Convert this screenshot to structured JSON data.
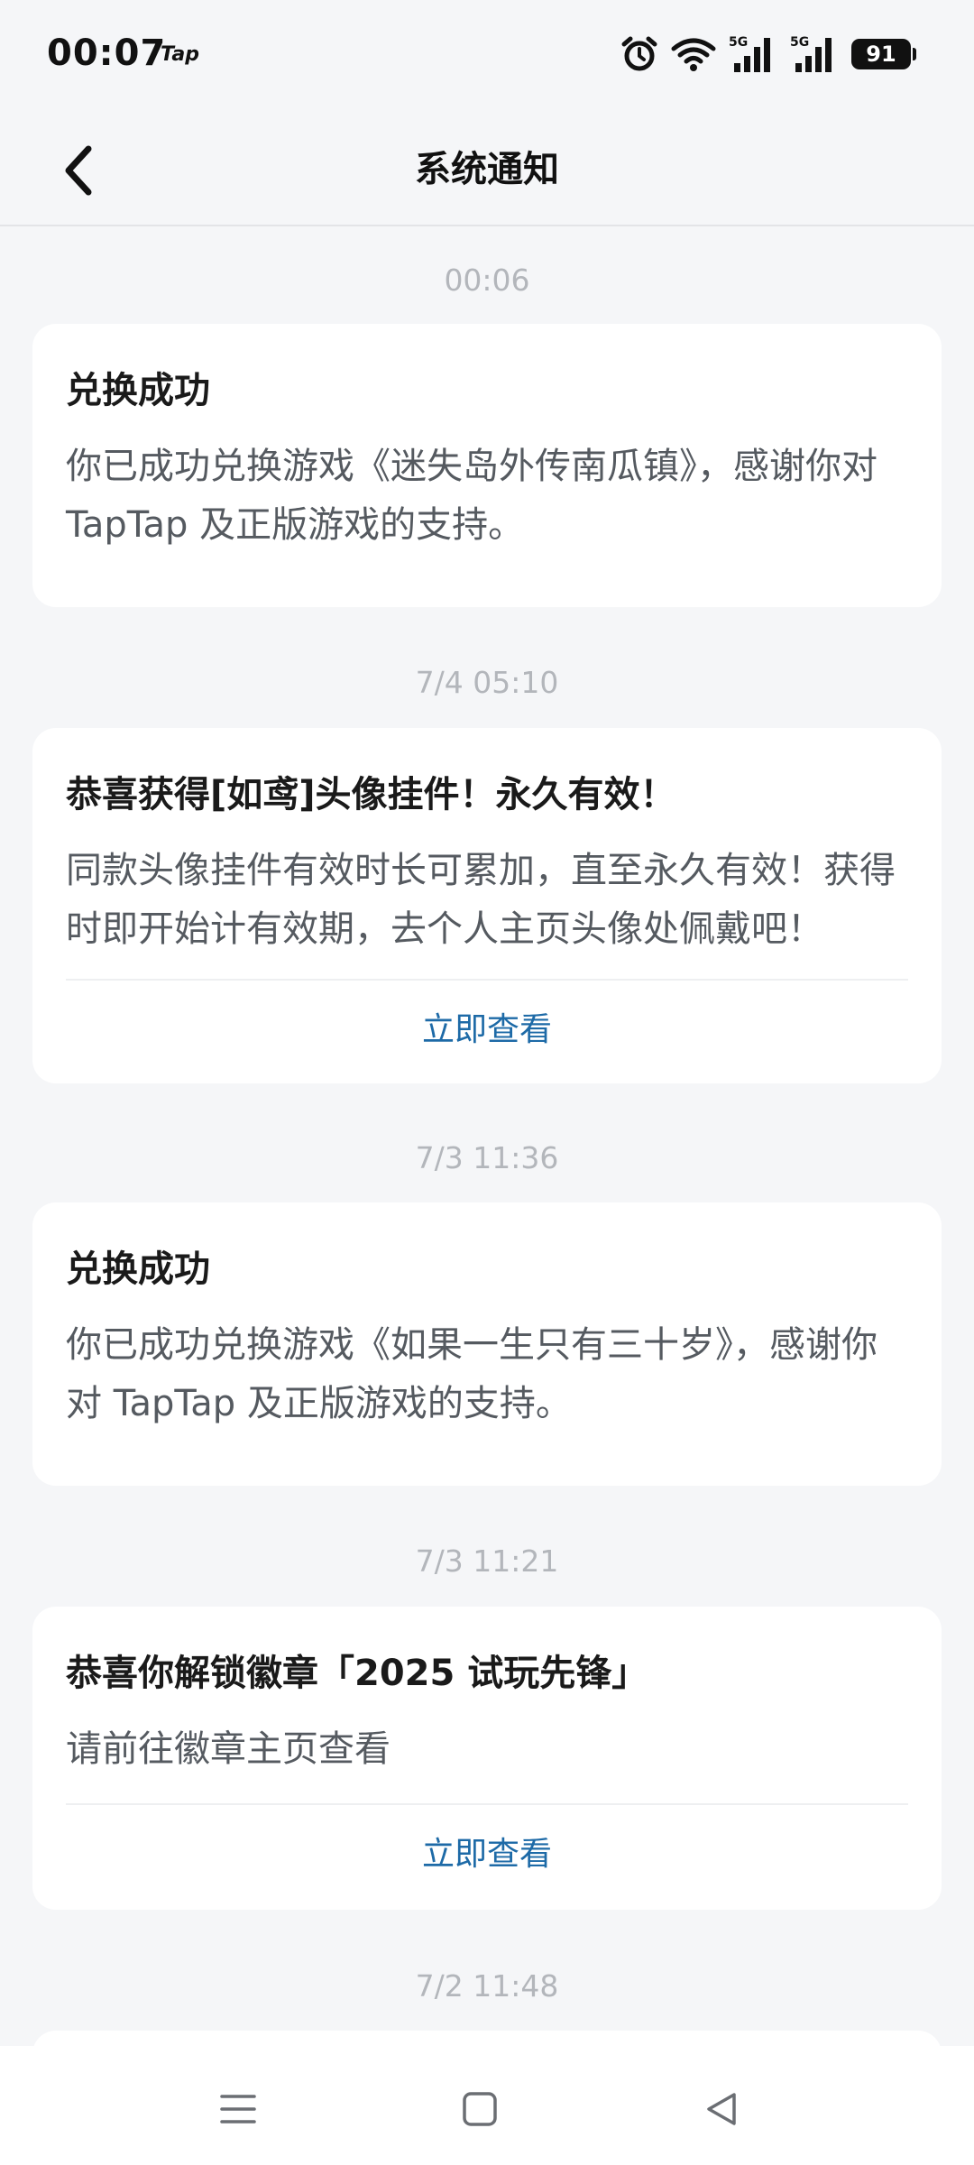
{
  "status_bar": {
    "time": "00:07",
    "app_label": "Tap",
    "network_1": "5G",
    "network_2": "5G",
    "battery": "91"
  },
  "header": {
    "title": "系统通知"
  },
  "notifications": [
    {
      "timestamp": "00:06",
      "title": "兑换成功",
      "body": "你已成功兑换游戏《迷失岛外传南瓜镇》，感谢你对 TapTap 及正版游戏的支持。"
    },
    {
      "timestamp": "7/4  05:10",
      "title": "恭喜获得[如鸢]头像挂件！永久有效！",
      "body": "同款头像挂件有效时长可累加，直至永久有效！获得时即开始计有效期，去个人主页头像处佩戴吧！",
      "action": "立即查看"
    },
    {
      "timestamp": "7/3  11:36",
      "title": "兑换成功",
      "body": "你已成功兑换游戏《如果一生只有三十岁》，感谢你对 TapTap 及正版游戏的支持。"
    },
    {
      "timestamp": "7/3  11:21",
      "title": "恭喜你解锁徽章「2025 试玩先锋」",
      "body": "请前往徽章主页查看",
      "action": "立即查看"
    },
    {
      "timestamp": "7/2  11:48"
    }
  ],
  "colors": {
    "background": "#f5f6f8",
    "card": "#ffffff",
    "link": "#1d6aa7",
    "timestamp": "#b3b6bb"
  },
  "icons": {
    "back": "chevron-left-icon",
    "alarm": "alarm-icon",
    "wifi": "wifi-icon",
    "signal": "signal-icon",
    "menu": "menu-icon",
    "home": "home-icon",
    "back_nav": "back-triangle-icon"
  }
}
